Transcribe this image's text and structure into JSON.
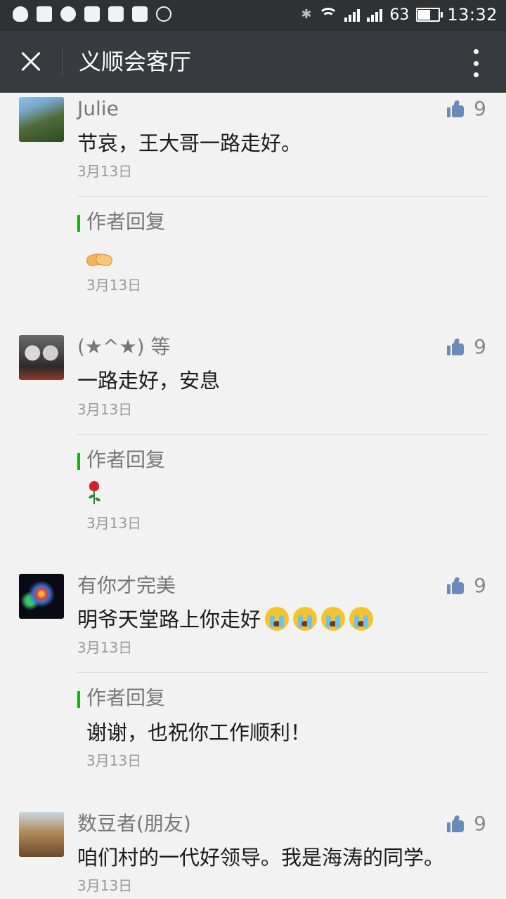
{
  "status_bar": {
    "battery_level": "63",
    "battery_fraction": 0.63,
    "time": "13:32",
    "notification_icons": [
      "qq-icon",
      "message-icon",
      "q-icon",
      "image-icon",
      "leme-icon",
      "app-grid-icon",
      "more-circle-icon"
    ]
  },
  "header": {
    "title": "义顺会客厅"
  },
  "comments": [
    {
      "name": "Julie",
      "text": "节哀，王大哥一路走好。",
      "date": "3月13日",
      "likes": "9",
      "reply_label": "作者回复",
      "reply_text": "",
      "reply_emoji": "handshake",
      "reply_date": "3月13日"
    },
    {
      "name": "(★^★) 等",
      "text": "一路走好，安息",
      "date": "3月13日",
      "likes": "9",
      "reply_label": "作者回复",
      "reply_text": "",
      "reply_emoji": "rose",
      "reply_date": "3月13日"
    },
    {
      "name": "有你才完美",
      "text": "明爷天堂路上你走好",
      "text_emoji": "crying-face",
      "text_emoji_count": 4,
      "date": "3月13日",
      "likes": "9",
      "reply_label": "作者回复",
      "reply_text": "谢谢，也祝你工作顺利！",
      "reply_date": "3月13日"
    },
    {
      "name": "数豆者(朋友)",
      "text": "咱们村的一代好领导。我是海涛的同学。",
      "date": "3月13日",
      "likes": "9"
    }
  ],
  "colors": {
    "status_bar_bg": "#2f3132",
    "title_bar_bg": "#393a3f",
    "page_bg": "#f2f2f2",
    "reply_accent": "#1aad19",
    "like_icon": "#6a8ab8"
  }
}
